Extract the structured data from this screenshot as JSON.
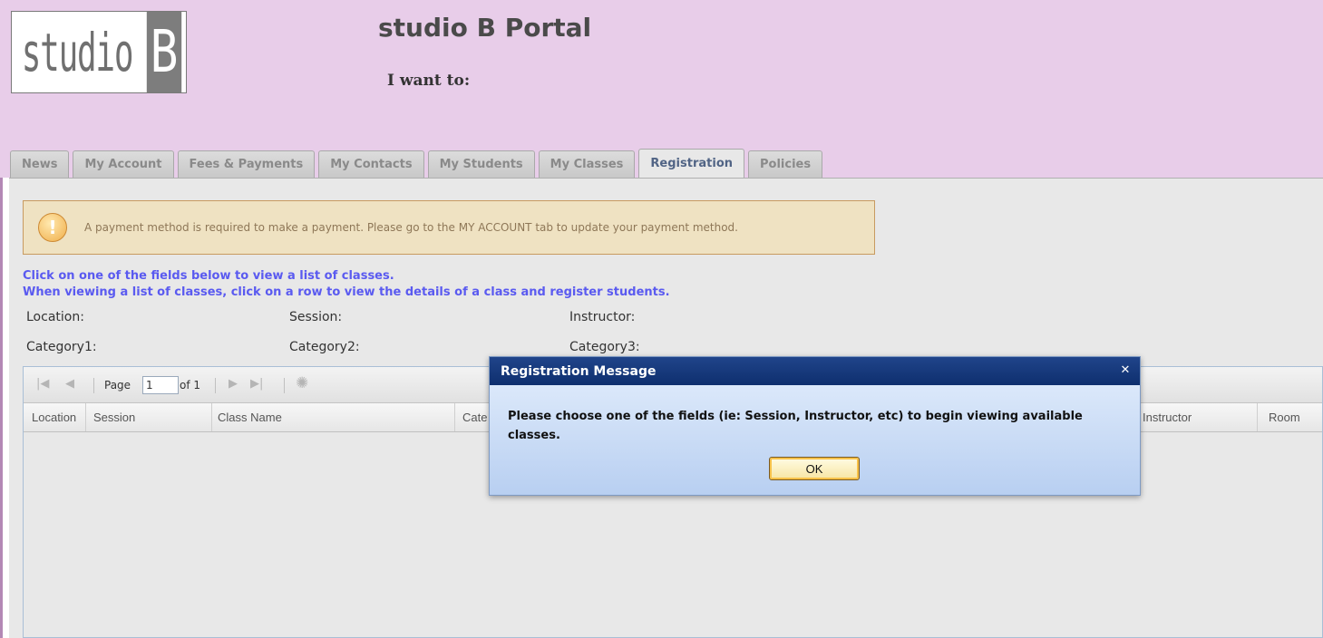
{
  "header": {
    "logo": {
      "word": "studio",
      "letter": "B"
    },
    "title": "studio B Portal",
    "subtitle": "I want to:"
  },
  "tabs": [
    {
      "label": "News",
      "active": false
    },
    {
      "label": "My Account",
      "active": false
    },
    {
      "label": "Fees & Payments",
      "active": false
    },
    {
      "label": "My Contacts",
      "active": false
    },
    {
      "label": "My Students",
      "active": false
    },
    {
      "label": "My Classes",
      "active": false
    },
    {
      "label": "Registration",
      "active": true
    },
    {
      "label": "Policies",
      "active": false
    }
  ],
  "warning": {
    "icon": "exclamation-icon",
    "text": "A payment method is required to make a payment. Please go to the MY ACCOUNT tab to update your payment method."
  },
  "instructions": [
    "Click on one of the fields below to view a list of classes.",
    "When viewing a list of classes, click on a row to view the details of a class and register students."
  ],
  "filters": {
    "location": "Location:",
    "session": "Session:",
    "instructor": "Instructor:",
    "category1": "Category1:",
    "category2": "Category2:",
    "category3": "Category3:"
  },
  "pager": {
    "page_label": "Page",
    "page_value": "1",
    "of_label": "of 1",
    "icons": [
      "first-page-icon",
      "prev-page-icon",
      "next-page-icon",
      "last-page-icon",
      "refresh-icon"
    ]
  },
  "columns": [
    "Location",
    "Session",
    "Class Name",
    "Cate",
    "Instructor",
    "Room"
  ],
  "modal": {
    "title": "Registration Message",
    "message": "Please choose one of the fields (ie: Session, Instructor, etc) to begin viewing available classes.",
    "ok_label": "OK",
    "close_icon": "close-icon"
  },
  "colors": {
    "header_bg": "#e8cde9",
    "panel_bg": "#e8e8e8",
    "instruction_text": "#5a5af0",
    "modal_title_bg": "#1b3f82",
    "warning_bg": "#efe2c2"
  }
}
